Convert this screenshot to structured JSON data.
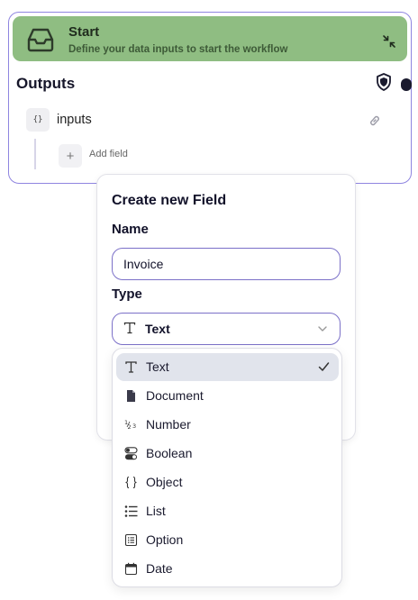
{
  "node": {
    "title": "Start",
    "subtitle": "Define your data inputs to start the workflow",
    "outputs_label": "Outputs",
    "field": {
      "type_badge": "{}",
      "name": "inputs"
    },
    "add_field_label": "Add field"
  },
  "create_field": {
    "title": "Create new Field",
    "name_label": "Name",
    "name_value": "Invoice",
    "type_label": "Type",
    "type_selected": "Text"
  },
  "type_options": [
    {
      "label": "Text",
      "icon": "text-type-icon",
      "selected": true
    },
    {
      "label": "Document",
      "icon": "document-icon",
      "selected": false
    },
    {
      "label": "Number",
      "icon": "number-icon",
      "selected": false
    },
    {
      "label": "Boolean",
      "icon": "toggle-icon",
      "selected": false
    },
    {
      "label": "Object",
      "icon": "braces-icon",
      "selected": false
    },
    {
      "label": "List",
      "icon": "list-icon",
      "selected": false
    },
    {
      "label": "Option",
      "icon": "option-list-icon",
      "selected": false
    },
    {
      "label": "Date",
      "icon": "calendar-icon",
      "selected": false
    }
  ],
  "colors": {
    "header_green": "#8fbd82",
    "node_border": "#8f85e0",
    "input_border": "#7b70c8",
    "selected_row": "#e1e4ec"
  }
}
